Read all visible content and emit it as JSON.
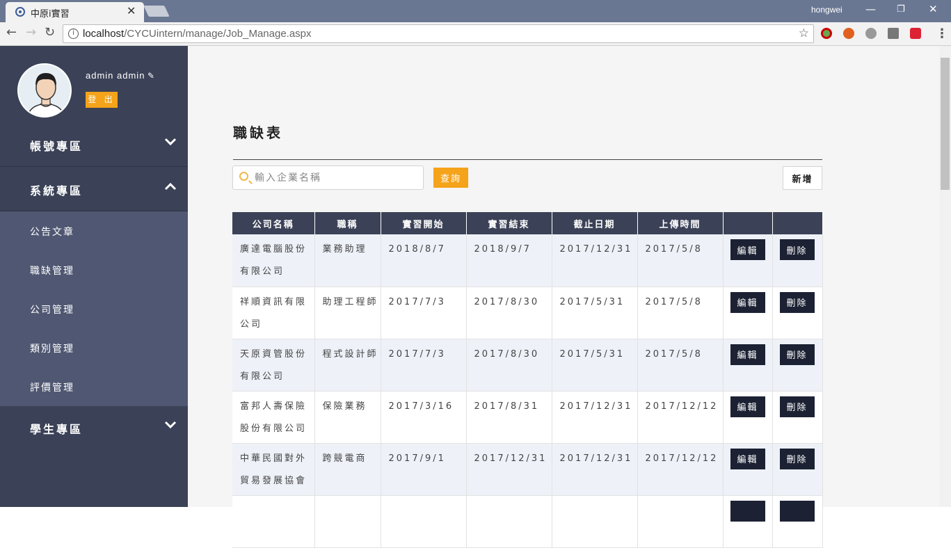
{
  "browser": {
    "tab_title": "中原i實習",
    "tab_close": "✕",
    "window_user": "hongwei",
    "url_host": "localhost",
    "url_path": "/CYCUintern/manage/Job_Manage.aspx"
  },
  "sidebar": {
    "username": "admin admin",
    "logout_label": "登 出",
    "groups": [
      {
        "label": "帳號專區",
        "chevron": "down"
      },
      {
        "label": "系統專區",
        "chevron": "up"
      },
      {
        "label": "學生專區",
        "chevron": "down"
      }
    ],
    "system_items": [
      "公告文章",
      "職缺管理",
      "公司管理",
      "類別管理",
      "評價管理"
    ]
  },
  "main": {
    "title": "職缺表",
    "search_placeholder": "輸入企業名稱",
    "query_label": "查詢",
    "add_label": "新增",
    "columns": [
      "公司名稱",
      "職稱",
      "實習開始",
      "實習結束",
      "截止日期",
      "上傳時間",
      "",
      ""
    ],
    "edit_label": "編輯",
    "delete_label": "刪除",
    "rows": [
      {
        "company": "廣達電腦股份有限公司",
        "title": "業務助理",
        "start": "2018/8/7",
        "end": "2018/9/7",
        "deadline": "2017/12/31",
        "uploaded": "2017/5/8"
      },
      {
        "company": "祥順資訊有限公司",
        "title": "助理工程師",
        "start": "2017/7/3",
        "end": "2017/8/30",
        "deadline": "2017/5/31",
        "uploaded": "2017/5/8"
      },
      {
        "company": "天原資管股份有限公司",
        "title": "程式設計師",
        "start": "2017/7/3",
        "end": "2017/8/30",
        "deadline": "2017/5/31",
        "uploaded": "2017/5/8"
      },
      {
        "company": "富邦人壽保險股份有限公司",
        "title": "保險業務",
        "start": "2017/3/16",
        "end": "2017/8/31",
        "deadline": "2017/12/31",
        "uploaded": "2017/12/12"
      },
      {
        "company": "中華民國對外貿易發展協會",
        "title": "跨競電商",
        "start": "2017/9/1",
        "end": "2017/12/31",
        "deadline": "2017/12/31",
        "uploaded": "2017/12/12"
      }
    ]
  },
  "colors": {
    "sidebar_bg": "#3b4257",
    "subnav_bg": "#4f5772",
    "accent": "#f5a31a",
    "action_button": "#1c2233"
  },
  "icons": [
    "info-icon",
    "star-icon",
    "pencil-icon",
    "search-icon",
    "chevron-down-icon",
    "chevron-up-icon",
    "avatar"
  ]
}
